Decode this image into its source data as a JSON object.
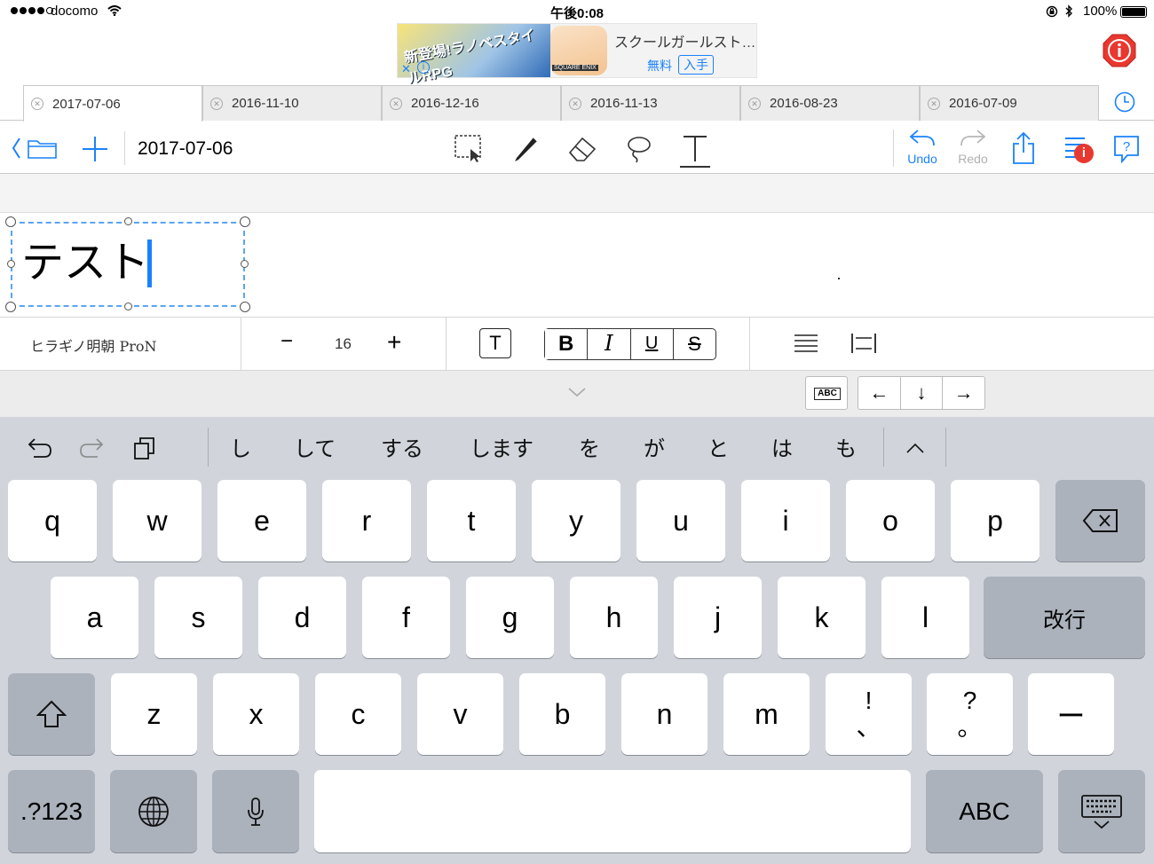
{
  "status_bar": {
    "carrier": "docomo",
    "time": "午後0:08",
    "battery_percent": "100%"
  },
  "ad": {
    "game_logo_text": "新登場!ラノベスタイルRPG",
    "title": "スクールガールスト…",
    "price": "無料",
    "get_label": "入手",
    "publisher": "SQUARE ENIX"
  },
  "tabs": [
    {
      "label": "2017-07-06",
      "active": true
    },
    {
      "label": "2016-11-10",
      "active": false
    },
    {
      "label": "2016-12-16",
      "active": false
    },
    {
      "label": "2016-11-13",
      "active": false
    },
    {
      "label": "2016-08-23",
      "active": false
    },
    {
      "label": "2016-07-09",
      "active": false
    }
  ],
  "toolbar": {
    "document_title": "2017-07-06",
    "undo_label": "Undo",
    "redo_label": "Redo",
    "tools": [
      "select-icon",
      "pen-icon",
      "eraser-icon",
      "lasso-icon",
      "text-tool-icon"
    ],
    "accent_color": "#1a82fb"
  },
  "canvas": {
    "text": "テスト"
  },
  "format_bar": {
    "font_name": "ヒラギノ明朝 ProN",
    "font_size": "16",
    "minus_label": "−",
    "plus_label": "+",
    "text_box_label": "T",
    "bold_label": "B",
    "italic_label": "I",
    "underline_label": "U",
    "strike_label": "S"
  },
  "accessory": {
    "abc_label": "ABC",
    "arrows": [
      "←",
      "↓",
      "→"
    ]
  },
  "keyboard": {
    "candidates": [
      "し",
      "して",
      "する",
      "します",
      "を",
      "が",
      "と",
      "は",
      "も"
    ],
    "row1": [
      "q",
      "w",
      "e",
      "r",
      "t",
      "y",
      "u",
      "i",
      "o",
      "p"
    ],
    "row2": [
      "a",
      "s",
      "d",
      "f",
      "g",
      "h",
      "j",
      "k",
      "l"
    ],
    "row3": [
      "z",
      "x",
      "c",
      "v",
      "b",
      "n",
      "m"
    ],
    "exclaim_top": "!",
    "exclaim_bottom": "、",
    "question_top": "?",
    "question_bottom": "。",
    "dash_key": "ー",
    "return_label": "改行",
    "numbers_label": ".?123",
    "abc_label": "ABC"
  }
}
